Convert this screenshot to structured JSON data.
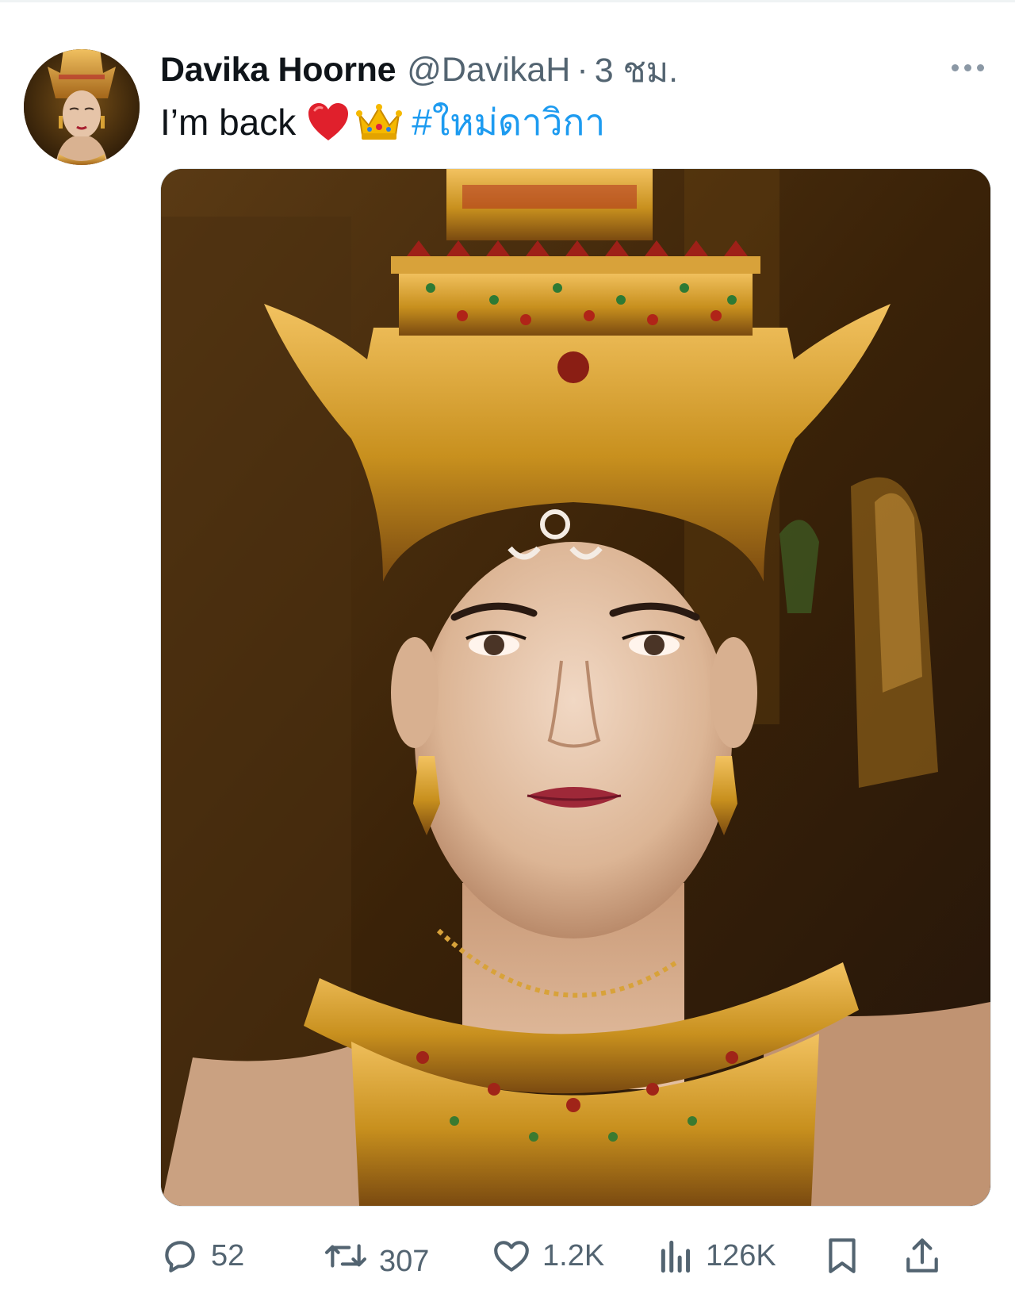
{
  "tweet": {
    "author": {
      "display_name": "Davika Hoorne",
      "handle": "@DavikaH",
      "separator": "·",
      "timestamp": "3 ชม."
    },
    "text": "I’m back",
    "emojis": [
      "red-heart",
      "crown"
    ],
    "hashtag": "#ใหม่ดาวิกา",
    "media": {
      "type": "photo",
      "content": "woman in golden Thai traditional crown and jewelry"
    },
    "actions": {
      "replies": "52",
      "reposts": "307",
      "likes": "1.2K",
      "views": "126K"
    },
    "icons": [
      "more-icon",
      "reply-icon",
      "repost-icon",
      "like-icon",
      "views-icon",
      "bookmark-icon",
      "share-icon"
    ]
  },
  "colors": {
    "text_primary": "#0f1419",
    "text_secondary": "#536471",
    "link": "#1d9bf0",
    "gold": "#c8901e"
  }
}
